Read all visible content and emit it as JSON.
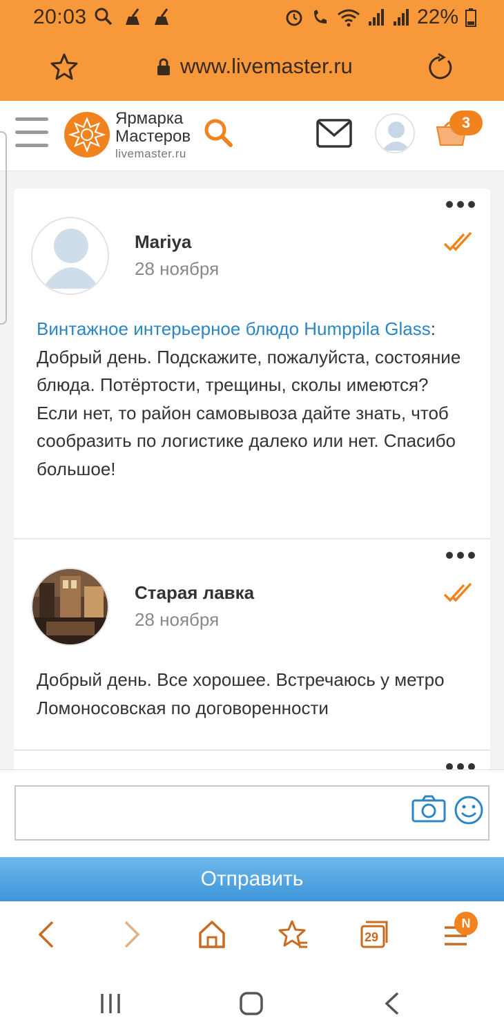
{
  "status_bar": {
    "time": "20:03",
    "battery": "22%"
  },
  "browser": {
    "url": "www.livemaster.ru",
    "tabs_count": "29",
    "menu_badge": "N"
  },
  "site": {
    "logo_line1": "Ярмарка",
    "logo_line2": "Мастеров",
    "logo_sub": "livemaster.ru",
    "cart_count": "3"
  },
  "colors": {
    "brand_orange": "#f7993a",
    "link_blue": "#2a86c5",
    "send_blue": "#4a9fe0"
  },
  "messages": [
    {
      "author": "Mariya",
      "date": "28 ноября",
      "link_text": "Винтажное интерьерное блюдо Humppila Glass",
      "link_suffix": ":",
      "body": "Добрый день. Подскажите, пожалуйста, состояние блюда. Потёртости, трещины, сколы имеются? Если нет, то район самовывоза дайте знать, чтоб сообразить по логистике далеко или нет. Спасибо большое!"
    },
    {
      "author": "Старая лавка",
      "date": "28 ноября",
      "body": "Добрый день. Все хорошее. Встречаюсь у метро Ломоносовская по договоренности"
    }
  ],
  "compose": {
    "placeholder": "",
    "send_label": "Отправить"
  }
}
